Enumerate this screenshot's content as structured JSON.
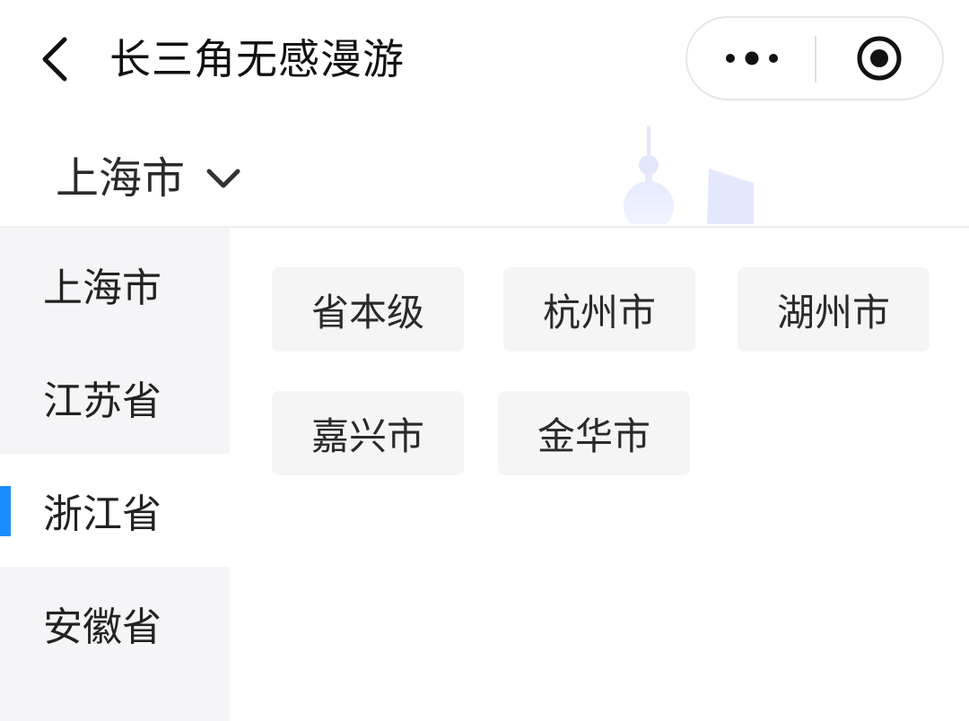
{
  "navbar": {
    "title": "长三角无感漫游",
    "back_icon": "chevron-left-icon",
    "more_icon": "more-dots-icon",
    "close_icon": "target-close-icon"
  },
  "region": {
    "selected": "上海市",
    "chevron_icon": "chevron-down-icon",
    "decoration_icon": "skyline-illustration"
  },
  "sidebar": {
    "items": [
      {
        "label": "上海市",
        "active": false
      },
      {
        "label": "江苏省",
        "active": false
      },
      {
        "label": "浙江省",
        "active": true
      },
      {
        "label": "安徽省",
        "active": false
      }
    ]
  },
  "cities": [
    {
      "label": "省本级"
    },
    {
      "label": "杭州市"
    },
    {
      "label": "湖州市"
    },
    {
      "label": "嘉兴市"
    },
    {
      "label": "金华市"
    }
  ],
  "colors": {
    "accent": "#1a8cff",
    "sidebar_bg": "#f5f5f7",
    "chip_bg": "#f5f5f6"
  }
}
